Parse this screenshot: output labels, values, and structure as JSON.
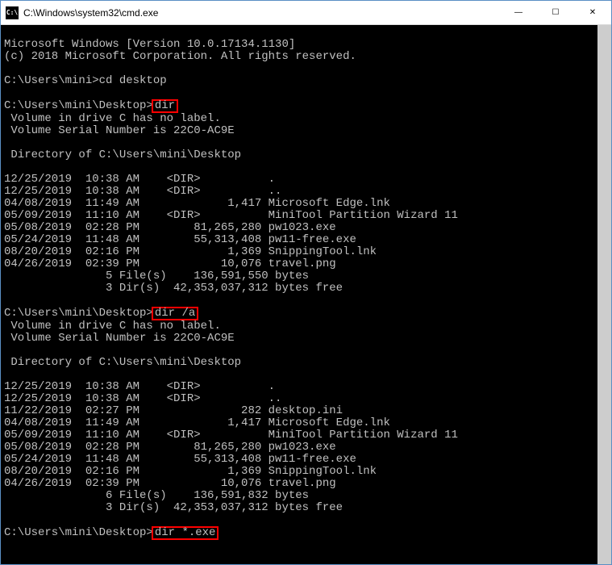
{
  "titlebar": {
    "icon_text": "C:\\",
    "title": "C:\\Windows\\system32\\cmd.exe"
  },
  "win_controls": {
    "minimize": "—",
    "maximize": "☐",
    "close": "✕"
  },
  "console": {
    "header1": "Microsoft Windows [Version 10.0.17134.1130]",
    "header2": "(c) 2018 Microsoft Corporation. All rights reserved.",
    "blank": "",
    "prompt1": "C:\\Users\\mini>",
    "cmd1": "cd desktop",
    "prompt2": "C:\\Users\\mini\\Desktop>",
    "cmd2": "dir",
    "vol1": " Volume in drive C has no label.",
    "vol2": " Volume Serial Number is 22C0-AC9E",
    "dirof": " Directory of C:\\Users\\mini\\Desktop",
    "listing1": [
      "12/25/2019  10:38 AM    <DIR>          .",
      "12/25/2019  10:38 AM    <DIR>          ..",
      "04/08/2019  11:49 AM             1,417 Microsoft Edge.lnk",
      "05/09/2019  11:10 AM    <DIR>          MiniTool Partition Wizard 11",
      "05/08/2019  02:28 PM        81,265,280 pw1023.exe",
      "05/24/2019  11:48 AM        55,313,408 pw11-free.exe",
      "08/20/2019  02:16 PM             1,369 SnippingTool.lnk",
      "04/26/2019  02:39 PM            10,076 travel.png",
      "               5 File(s)    136,591,550 bytes",
      "               3 Dir(s)  42,353,037,312 bytes free"
    ],
    "prompt3": "C:\\Users\\mini\\Desktop>",
    "cmd3": "dir /a",
    "listing2": [
      "12/25/2019  10:38 AM    <DIR>          .",
      "12/25/2019  10:38 AM    <DIR>          ..",
      "11/22/2019  02:27 PM               282 desktop.ini",
      "04/08/2019  11:49 AM             1,417 Microsoft Edge.lnk",
      "05/09/2019  11:10 AM    <DIR>          MiniTool Partition Wizard 11",
      "05/08/2019  02:28 PM        81,265,280 pw1023.exe",
      "05/24/2019  11:48 AM        55,313,408 pw11-free.exe",
      "08/20/2019  02:16 PM             1,369 SnippingTool.lnk",
      "04/26/2019  02:39 PM            10,076 travel.png",
      "               6 File(s)    136,591,832 bytes",
      "               3 Dir(s)  42,353,037,312 bytes free"
    ],
    "prompt4": "C:\\Users\\mini\\Desktop>",
    "cmd4": "dir *.exe"
  }
}
